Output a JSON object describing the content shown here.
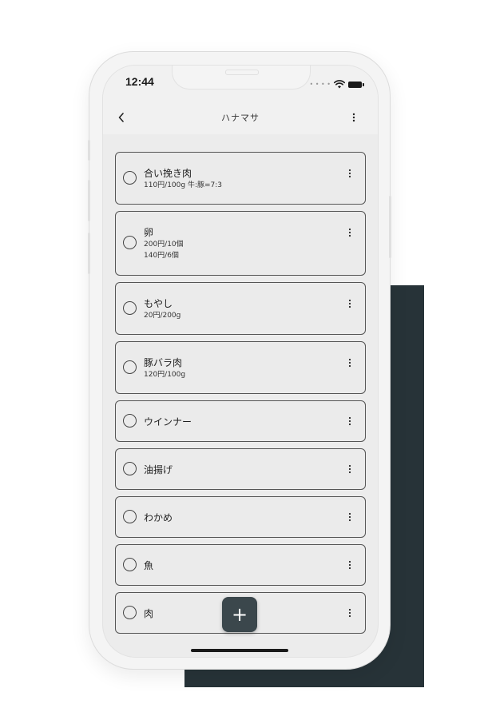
{
  "status_bar": {
    "time": "12:44",
    "signal_icon": "cellular-dots-icon",
    "wifi_icon": "wifi-icon",
    "battery_icon": "battery-icon"
  },
  "app_bar": {
    "back_icon": "chevron-left-icon",
    "title": "ハナマサ",
    "more_icon": "more-vertical-icon"
  },
  "items": [
    {
      "title": "合い挽き肉",
      "details": [
        "110円/100g 牛:豚=7:3"
      ],
      "checked": false
    },
    {
      "title": "卵",
      "details": [
        "200円/10個",
        "140円/6個"
      ],
      "checked": false
    },
    {
      "title": "もやし",
      "details": [
        "20円/200g"
      ],
      "checked": false
    },
    {
      "title": "豚バラ肉",
      "details": [
        "120円/100g"
      ],
      "checked": false
    },
    {
      "title": "ウインナー",
      "details": [],
      "checked": false
    },
    {
      "title": "油揚げ",
      "details": [],
      "checked": false
    },
    {
      "title": "わかめ",
      "details": [],
      "checked": false
    },
    {
      "title": "魚",
      "details": [],
      "checked": false
    },
    {
      "title": "肉",
      "details": [],
      "checked": false
    }
  ],
  "fab": {
    "label": "+",
    "icon": "plus-icon"
  },
  "colors": {
    "accent_dark": "#273338",
    "fab_background": "#3b474c",
    "screen_background": "#ececec"
  }
}
